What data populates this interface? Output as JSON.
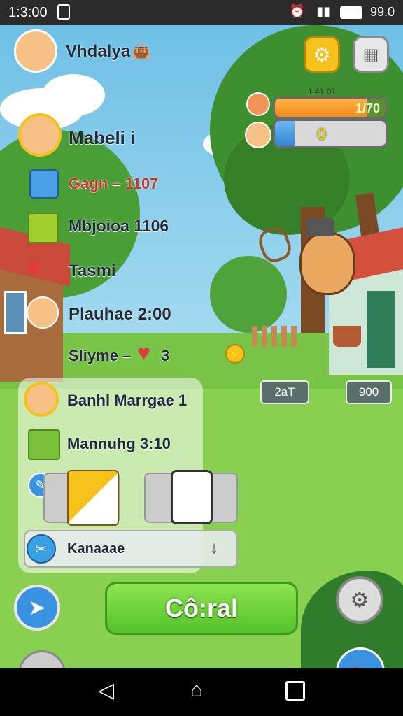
{
  "status_bar": {
    "time": "1:3:00",
    "right_text": "99.0"
  },
  "player": {
    "name": "Vhdalya"
  },
  "stats": [
    {
      "label": "Mabeli i"
    },
    {
      "label": "Gagn – 1107"
    },
    {
      "label": "Mbjoioa 1106"
    },
    {
      "label": "Tasmi"
    },
    {
      "label": "Plauhae 2:00"
    },
    {
      "label": "Sliyme –",
      "suffix": "3"
    }
  ],
  "top_bars": {
    "orange_value": "1/70",
    "blue_value": "0",
    "orange_fill": 0.83,
    "blue_fill": 0.18,
    "above_text": "1 41 01"
  },
  "scene_labels": {
    "left_chip": "2aT",
    "right_chip": "900"
  },
  "panel": {
    "rows": [
      {
        "label": "Banhl Marrgae 1"
      },
      {
        "label": "Mannuhg 3:10"
      }
    ],
    "bottom_row": {
      "label": "Kanaaae"
    }
  },
  "main_button": {
    "label": "Cô:ral"
  },
  "colors": {
    "accent_green": "#55c22a",
    "orange": "#f28a19",
    "blue": "#3a93e0",
    "gold": "#f6c11a"
  }
}
